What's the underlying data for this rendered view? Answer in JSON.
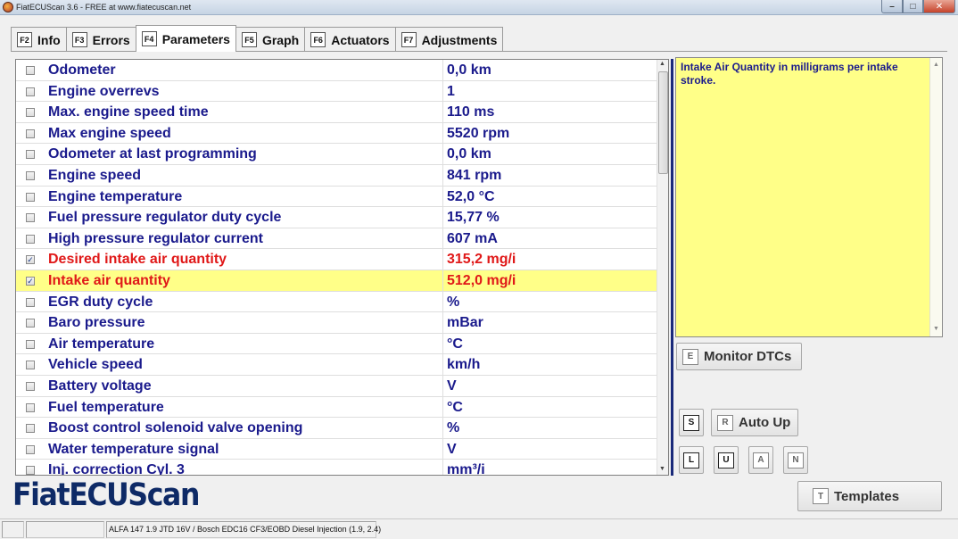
{
  "window": {
    "title": "FiatECUScan 3.6 - FREE at www.fiatecuscan.net",
    "minimize": "–",
    "maximize": "□",
    "close": "✕"
  },
  "tabs": [
    {
      "key": "F2",
      "label": "Info"
    },
    {
      "key": "F3",
      "label": "Errors"
    },
    {
      "key": "F4",
      "label": "Parameters",
      "active": true
    },
    {
      "key": "F5",
      "label": "Graph"
    },
    {
      "key": "F6",
      "label": "Actuators"
    },
    {
      "key": "F7",
      "label": "Adjustments"
    }
  ],
  "parameters": [
    {
      "name": "Odometer",
      "value": "0,0 km",
      "checked": false
    },
    {
      "name": "Engine overrevs",
      "value": "1",
      "checked": false
    },
    {
      "name": "Max. engine speed time",
      "value": "110 ms",
      "checked": false
    },
    {
      "name": "Max engine speed",
      "value": "5520 rpm",
      "checked": false
    },
    {
      "name": "Odometer at last programming",
      "value": "0,0 km",
      "checked": false
    },
    {
      "name": "Engine speed",
      "value": "841 rpm",
      "checked": false
    },
    {
      "name": "Engine temperature",
      "value": "52,0 °C",
      "checked": false
    },
    {
      "name": "Fuel pressure regulator duty cycle",
      "value": "15,77 %",
      "checked": false
    },
    {
      "name": "High pressure regulator current",
      "value": "607 mA",
      "checked": false
    },
    {
      "name": "Desired intake air quantity",
      "value": "315,2 mg/i",
      "checked": true,
      "red": true
    },
    {
      "name": "Intake air quantity",
      "value": "512,0 mg/i",
      "checked": true,
      "red": true,
      "selected": true
    },
    {
      "name": "EGR duty cycle",
      "value": " %",
      "checked": false
    },
    {
      "name": "Baro pressure",
      "value": " mBar",
      "checked": false
    },
    {
      "name": "Air temperature",
      "value": " °C",
      "checked": false
    },
    {
      "name": "Vehicle speed",
      "value": " km/h",
      "checked": false
    },
    {
      "name": "Battery voltage",
      "value": " V",
      "checked": false
    },
    {
      "name": "Fuel temperature",
      "value": " °C",
      "checked": false
    },
    {
      "name": "Boost control solenoid valve opening",
      "value": " %",
      "checked": false
    },
    {
      "name": "Water temperature signal",
      "value": " V",
      "checked": false
    },
    {
      "name": "Inj. correction Cyl. 3",
      "value": " mm³/i",
      "checked": false
    }
  ],
  "help": {
    "text": "Intake Air Quantity in milligrams per intake stroke."
  },
  "buttons": {
    "monitor_dtcs": {
      "key": "E",
      "label": "Monitor DTCs"
    },
    "s_key": "S",
    "auto_up": {
      "key": "R",
      "label": "Auto Up"
    },
    "l_key": "L",
    "u_key": "U",
    "a_key": "A",
    "n_key": "N",
    "templates": {
      "key": "T",
      "label": "Templates"
    }
  },
  "logo": {
    "text": "FiatECUScan"
  },
  "status": {
    "vehicle": "ALFA 147 1.9 JTD 16V / Bosch EDC16 CF3/EOBD Diesel Injection (1.9, 2.4)"
  },
  "colors": {
    "highlight": "#ffff88",
    "param_text": "#1a1a8c",
    "param_red": "#e01818",
    "divider": "#1a2a7a"
  }
}
